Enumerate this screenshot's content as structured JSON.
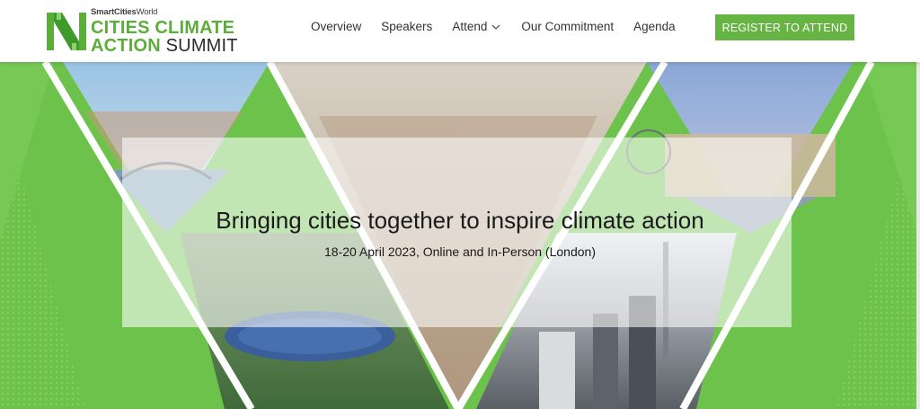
{
  "header": {
    "logo": {
      "brand_prefix_bold": "SmartCities",
      "brand_prefix_light": "World",
      "line1": "CITIES CLIMATE",
      "line2_green": "ACTION",
      "line2_dark": " SUMMIT"
    },
    "nav": [
      {
        "label": "Overview"
      },
      {
        "label": "Speakers"
      },
      {
        "label": "Attend",
        "has_dropdown": true
      },
      {
        "label": "Our Commitment"
      },
      {
        "label": "Agenda"
      }
    ],
    "register_label": "REGISTER TO ATTEND"
  },
  "hero": {
    "title": "Bringing cities together to inspire climate action",
    "subtitle": "18-20 April 2023, Online and In-Person (London)"
  },
  "colors": {
    "brand_green": "#5cae3a",
    "button_green": "#66b443",
    "hero_green": "#6cc24a"
  }
}
